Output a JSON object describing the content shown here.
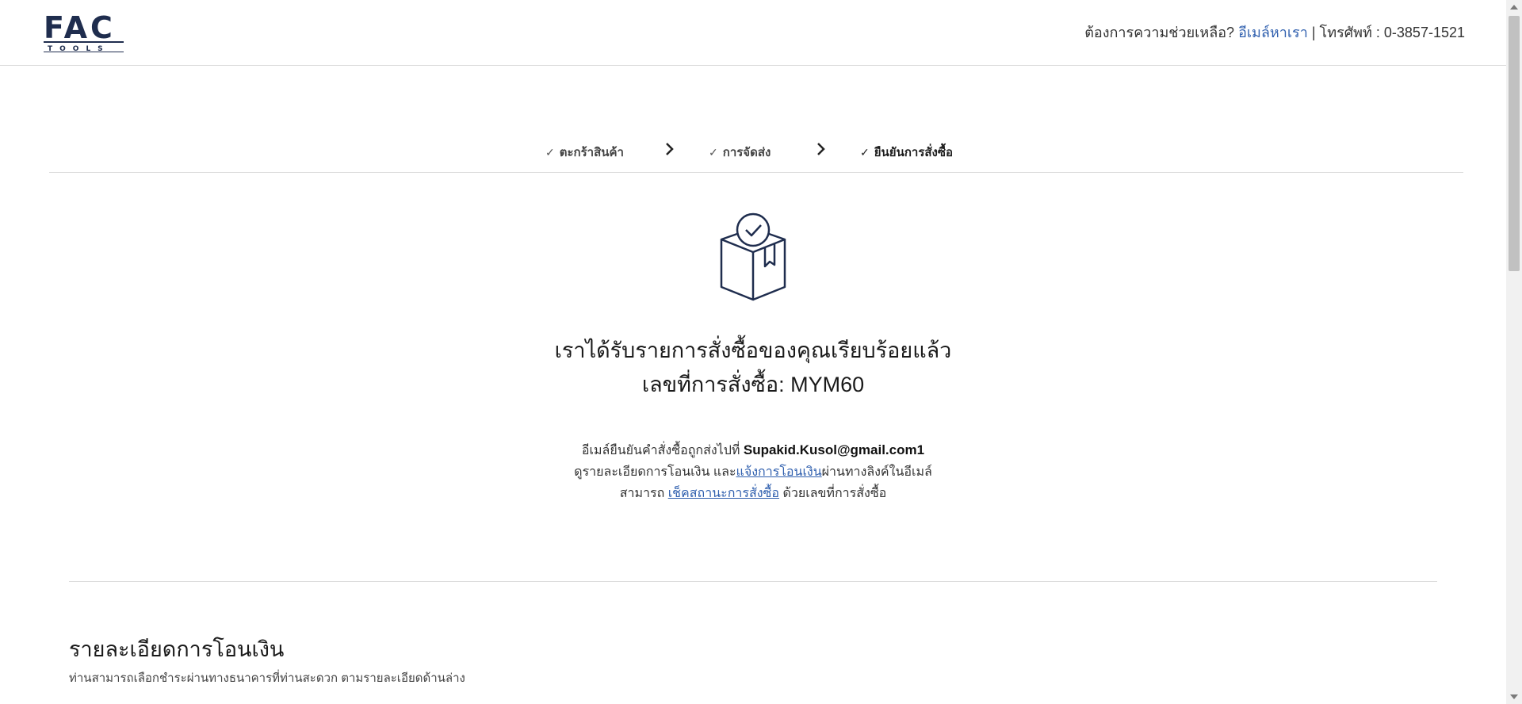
{
  "header": {
    "logo_text": "FAC TOOLS",
    "help_text": "ต้องการความช่วยเหลือ?",
    "email_link": "อีเมล์หาเรา",
    "separator": "|",
    "phone": "โทรศัพท์ : 0-3857-1521"
  },
  "steps": [
    {
      "label": "ตะกร้าสินค้า",
      "done": true
    },
    {
      "label": "การจัดส่ง",
      "done": true
    },
    {
      "label": "ยืนยันการสั่งซื้อ",
      "done": true,
      "active": true
    }
  ],
  "confirmation": {
    "title": "เราได้รับรายการสั่งซื้อของคุณเรียบร้อยแล้ว",
    "order_number_label": "เลขที่การสั่งซื้อ:",
    "order_number": "MYM60",
    "email_sent_text": "อีเมล์ยืนยันคำสั่งซื้อถูกส่งไปที่",
    "email": "Supakid.Kusol@gmail.com1",
    "transfer_prefix": "ดูรายละเอียดการโอนเงิน และ",
    "transfer_link": "แจ้งการโอนเงิน",
    "transfer_suffix": "ผ่านทางลิงค์ในอีเมล์",
    "status_prefix": "สามารถ",
    "status_link": "เช็คสถานะการสั่งซื้อ",
    "status_suffix": "ด้วยเลขที่การสั่งซื้อ"
  },
  "payment_section": {
    "title": "รายละเอียดการโอนเงิน",
    "subtitle": "ท่านสามารถเลือกชำระผ่านทางธนาคารที่ท่านสะดวก ตามรายละเอียดด้านล่าง"
  },
  "colors": {
    "navy": "#1f2d4e",
    "link": "#2f5fae"
  }
}
